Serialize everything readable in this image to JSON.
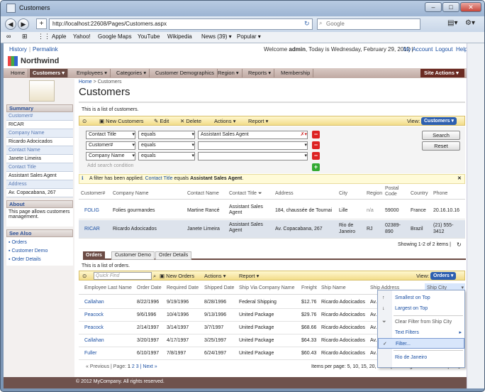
{
  "window": {
    "title": "Customers"
  },
  "browser": {
    "url": "http://localhost:22608/Pages/Customers.aspx",
    "search_placeholder": "Google"
  },
  "bookmarks": [
    "Apple",
    "Yahoo!",
    "Google Maps",
    "YouTube",
    "Wikipedia",
    "News (39) ▾",
    "Popular ▾"
  ],
  "top": {
    "history": "History",
    "sep": "|",
    "permalink": "Permalink",
    "welcome_pre": "Welcome ",
    "user": "admin",
    "welcome_post": ", Today is Wednesday, February 29, 2012",
    "my_account": "My Account",
    "logout": "Logout",
    "help": "Help"
  },
  "brand": "Northwind",
  "menu": [
    "Home",
    "Customers",
    "Employees",
    "Categories",
    "Customer Demographics",
    "Region",
    "Reports",
    "Membership"
  ],
  "site_actions": "Site Actions ▾",
  "sidebar": {
    "summary": "Summary",
    "fields": [
      {
        "label": "Customer#",
        "value": "RICAR"
      },
      {
        "label": "Company Name",
        "value": "Ricardo Adocicados"
      },
      {
        "label": "Contact Name",
        "value": "Janete Limeira"
      },
      {
        "label": "Contact Title",
        "value": "Assistant Sales Agent"
      },
      {
        "label": "Address",
        "value": "Av. Copacabana, 267"
      }
    ],
    "about": "About",
    "about_text": "This page allows customers management.",
    "see_also": "See Also",
    "links": [
      "Orders",
      "Customer Demo",
      "Order Details"
    ]
  },
  "breadcrumb": {
    "home": "Home",
    "sep": ">",
    "current": "Customers"
  },
  "page_title": "Customers",
  "list_desc": "This is a list of customers.",
  "toolbar": {
    "new": "New Customers",
    "edit": "Edit",
    "delete": "Delete",
    "actions": "Actions",
    "report": "Report",
    "view": "View:",
    "view_val": "Customers"
  },
  "filters": [
    {
      "field": "Contact Title",
      "op": "equals",
      "value": "Assistant Sales Agent"
    },
    {
      "field": "Customer#",
      "op": "equals",
      "value": ""
    },
    {
      "field": "Company Name",
      "op": "equals",
      "value": ""
    }
  ],
  "add_condition": "Add search condition",
  "search_btn": "Search",
  "reset_btn": "Reset",
  "filter_msg": {
    "pre": "A filter has been applied. ",
    "field": "Contact Title",
    "mid": " equals ",
    "val": "Assistant Sales Agent",
    "end": "."
  },
  "grid": {
    "headers": [
      "Customer#",
      "Company Name",
      "Contact Name",
      "Contact Title",
      "Address",
      "City",
      "Region",
      "Postal Code",
      "Country",
      "Phone"
    ],
    "rows": [
      [
        "FOLIG",
        "Folies gourmandes",
        "Martine Rancé",
        "Assistant Sales Agent",
        "184, chaussée de Tournai",
        "Lille",
        "n/a",
        "59000",
        "France",
        "20.16.10.16"
      ],
      [
        "RICAR",
        "Ricardo Adocicados",
        "Janete Limeira",
        "Assistant Sales Agent",
        "Av. Copacabana, 267",
        "Rio de Janeiro",
        "RJ",
        "02389-890",
        "Brazil",
        "(21) 555-3412"
      ]
    ],
    "showing": "Showing 1-2 of 2 items |"
  },
  "tabs": [
    "Orders",
    "Customer Demo",
    "Order Details"
  ],
  "orders": {
    "desc": "This is a list of orders.",
    "quickfind": "Quick Find",
    "new": "New Orders",
    "actions": "Actions",
    "report": "Report",
    "view": "View:",
    "view_val": "Orders",
    "headers": [
      "Employee Last Name",
      "Order Date",
      "Required Date",
      "Shipped Date",
      "Ship Via Company Name",
      "Freight",
      "Ship Name",
      "Ship Address",
      "Ship City"
    ],
    "rows": [
      [
        "Callahan",
        "8/22/1996",
        "9/19/1996",
        "8/28/1996",
        "Federal Shipping",
        "$12.76",
        "Ricardo Adocicados",
        "Av."
      ],
      [
        "Peacock",
        "9/6/1996",
        "10/4/1996",
        "9/13/1996",
        "United Package",
        "$29.76",
        "Ricardo Adocicados",
        "Av."
      ],
      [
        "Peacock",
        "2/14/1997",
        "3/14/1997",
        "3/7/1997",
        "United Package",
        "$68.66",
        "Ricardo Adocicados",
        "Av."
      ],
      [
        "Callahan",
        "3/20/1997",
        "4/17/1997",
        "3/25/1997",
        "United Package",
        "$64.33",
        "Ricardo Adocicados",
        "Av."
      ],
      [
        "Fuller",
        "6/10/1997",
        "7/8/1997",
        "6/24/1997",
        "United Package",
        "$60.43",
        "Ricardo Adocicados",
        "Av."
      ]
    ],
    "pager_prev": "« Previous",
    "pager_sep": "| Page:",
    "pages": [
      "1",
      "2",
      "3"
    ],
    "pager_next": "| Next »",
    "items_per_page": "Items per page: 5, 10, 15, 20, 25",
    "showing": "| Showing 1-5 of 11 items |"
  },
  "popup": [
    "Smallest on Top",
    "Largest on Top",
    "Clear Filter from Ship City",
    "Text Filters",
    "Filter...",
    "Rio de Janeiro"
  ],
  "footer": "© 2012 MyCompany. All rights reserved."
}
